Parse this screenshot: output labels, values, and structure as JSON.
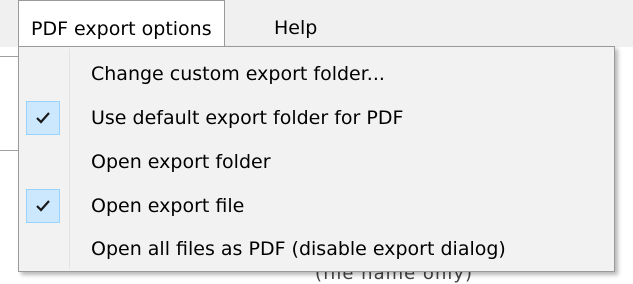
{
  "menubar": {
    "items": [
      {
        "label": "PDF export options",
        "open": true
      },
      {
        "label": "Help",
        "open": false
      }
    ]
  },
  "menu": {
    "items": [
      {
        "label": "Change custom export folder...",
        "checked": false
      },
      {
        "label": "Use default export folder for PDF",
        "checked": true
      },
      {
        "label": "Open export folder",
        "checked": false
      },
      {
        "label": "Open export file",
        "checked": true
      },
      {
        "label": "Open all files as PDF (disable export dialog)",
        "checked": false
      }
    ]
  },
  "background": {
    "partial_text": "(file name only)"
  },
  "colors": {
    "check_bg": "#cce8ff",
    "check_border": "#99d1ff",
    "menu_bg": "#f2f2f2",
    "menubar_bg": "#f0f0f0"
  }
}
